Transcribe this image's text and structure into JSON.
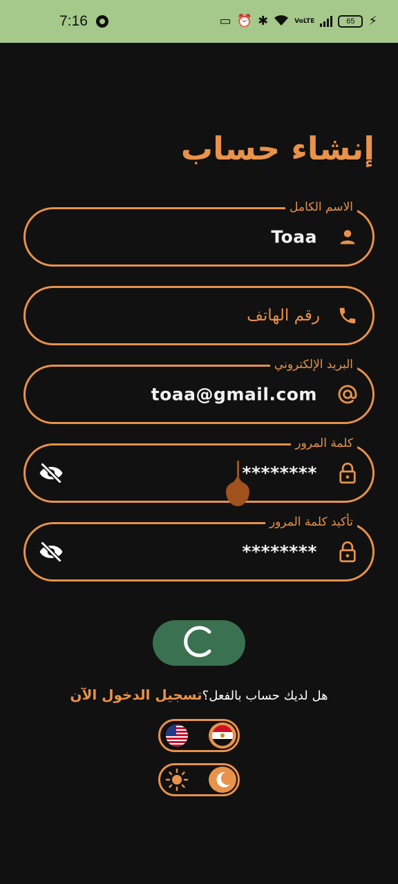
{
  "status_bar": {
    "time": "7:16",
    "network_label": "VoLTE",
    "battery_level": "65"
  },
  "title": "إنشاء حساب",
  "fields": {
    "full_name": {
      "label": "الاسم الكامل",
      "value": "Toaa",
      "icon": "person-icon"
    },
    "phone": {
      "placeholder": "رقم الهاتف",
      "icon": "phone-icon"
    },
    "email": {
      "label": "البريد الإلكتروني",
      "value": "toaa@gmail.com",
      "icon": "at-icon"
    },
    "password": {
      "label": "كلمة المرور",
      "value": "********",
      "icon": "lock-icon",
      "toggle_icon": "eye-off-icon"
    },
    "confirm_password": {
      "label": "تأكيد كلمة المرور",
      "value": "********",
      "icon": "lock-icon",
      "toggle_icon": "eye-off-icon"
    }
  },
  "submit": {
    "state": "loading",
    "icon": "spinner-icon",
    "color": "#3a7150"
  },
  "login_prompt": {
    "question": "هل لديك حساب بالفعل؟",
    "link": "تسجيل الدخول الآن"
  },
  "language_toggle": {
    "options": [
      "us-flag-icon",
      "egypt-flag-icon"
    ],
    "selected": "egypt-flag-icon"
  },
  "theme_toggle": {
    "options": [
      "sun-icon",
      "moon-icon"
    ],
    "selected": "moon-icon"
  },
  "colors": {
    "accent": "#e8924a",
    "background": "#111111",
    "status_bar": "#a5c98a",
    "button": "#3a7150"
  }
}
